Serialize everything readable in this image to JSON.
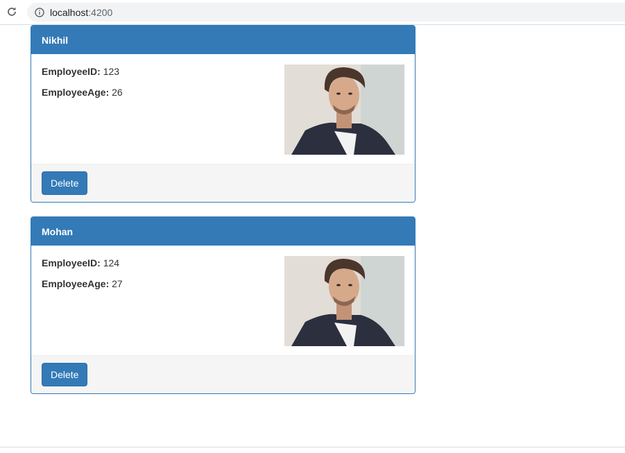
{
  "browser": {
    "url_host": "localhost",
    "url_port": ":4200"
  },
  "employees": [
    {
      "name": "Nikhil",
      "id_label": "EmployeeID:",
      "id": "123",
      "age_label": "EmployeeAge:",
      "age": "26",
      "delete_label": "Delete"
    },
    {
      "name": "Mohan",
      "id_label": "EmployeeID:",
      "id": "124",
      "age_label": "EmployeeAge:",
      "age": "27",
      "delete_label": "Delete"
    }
  ],
  "colors": {
    "primary": "#337ab7",
    "footer_bg": "#f5f5f5"
  }
}
